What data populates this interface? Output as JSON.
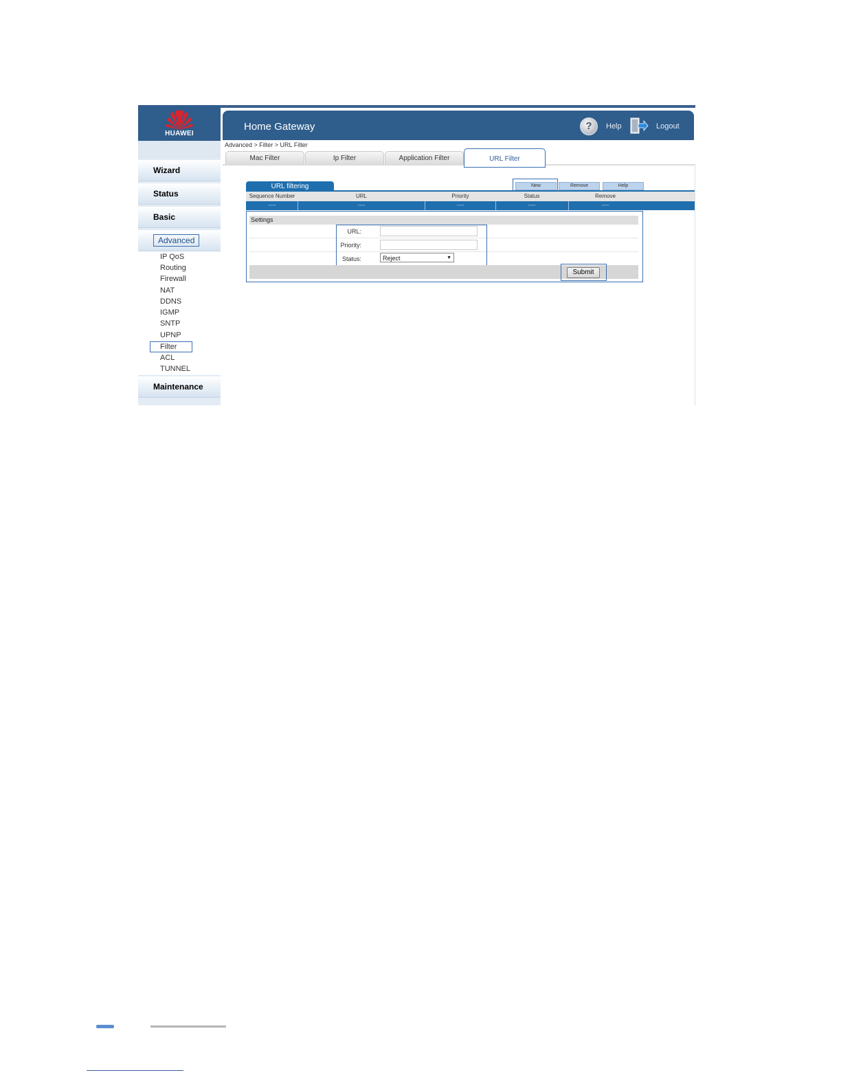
{
  "brand": {
    "wordmark": "HUAWEI",
    "header_color": "#2f5d8c",
    "accent_color": "#1f6fae"
  },
  "header": {
    "title": "Home Gateway",
    "help_label": "Help",
    "logout_label": "Logout",
    "help_glyph": "?"
  },
  "breadcrumb": "Advanced > Filter > URL Filter",
  "sidebar": {
    "sections": [
      "Wizard",
      "Status",
      "Basic",
      "Advanced",
      "Maintenance"
    ],
    "active_section": "Advanced",
    "advanced_items": [
      "IP QoS",
      "Routing",
      "Firewall",
      "NAT",
      "DDNS",
      "IGMP",
      "SNTP",
      "UPNP",
      "Filter",
      "ACL",
      "TUNNEL"
    ],
    "selected_item": "Filter"
  },
  "tabs": [
    "Mac Filter",
    "Ip Filter",
    "Application Filter",
    "URL Filter"
  ],
  "active_tab": "URL Filter",
  "panel": {
    "title": "URL filtering",
    "actions": [
      "New",
      "Remove",
      "Help"
    ],
    "columns": [
      "Sequence Number",
      "URL",
      "Priority",
      "Status",
      "Remove"
    ],
    "empty_row": [
      "----",
      "----",
      "----",
      "----",
      "----"
    ]
  },
  "settings": {
    "title": "Settings",
    "url_label": "URL:",
    "url_value": "",
    "priority_label": "Priority:",
    "priority_value": "",
    "status_label": "Status:",
    "status_value": "Reject",
    "submit_label": "Submit"
  }
}
